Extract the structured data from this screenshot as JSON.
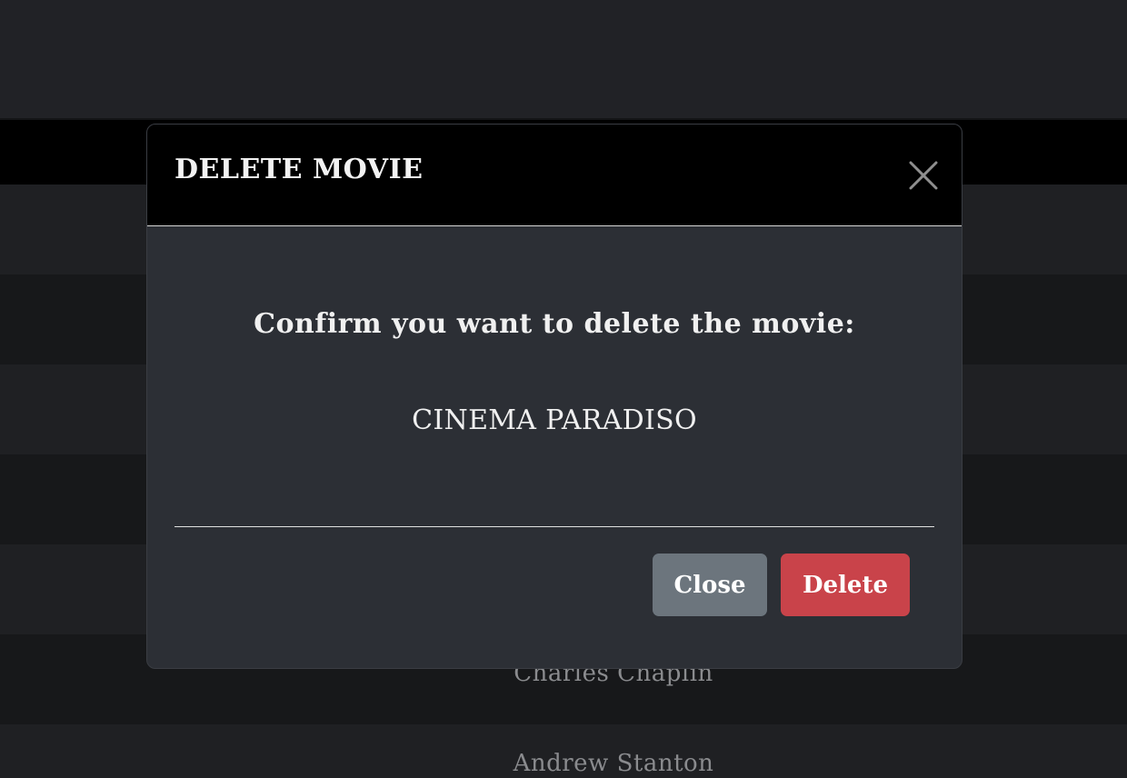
{
  "background_rows": [
    {
      "director": ""
    },
    {
      "director": ""
    },
    {
      "director": ""
    },
    {
      "director": ""
    },
    {
      "director": ""
    },
    {
      "director": "Charles Chaplin"
    },
    {
      "director": "Andrew Stanton"
    }
  ],
  "modal": {
    "title": "DELETE MOVIE",
    "close_icon": "close-icon",
    "confirm_text": "Confirm you want to delete the movie:",
    "movie_title": "CINEMA PARADISO",
    "close_button_label": "Close",
    "delete_button_label": "Delete"
  },
  "colors": {
    "header_bg": "#000000",
    "modal_bg": "#2c2f35",
    "close_button": "#6c757d",
    "delete_button": "#c9434a"
  }
}
